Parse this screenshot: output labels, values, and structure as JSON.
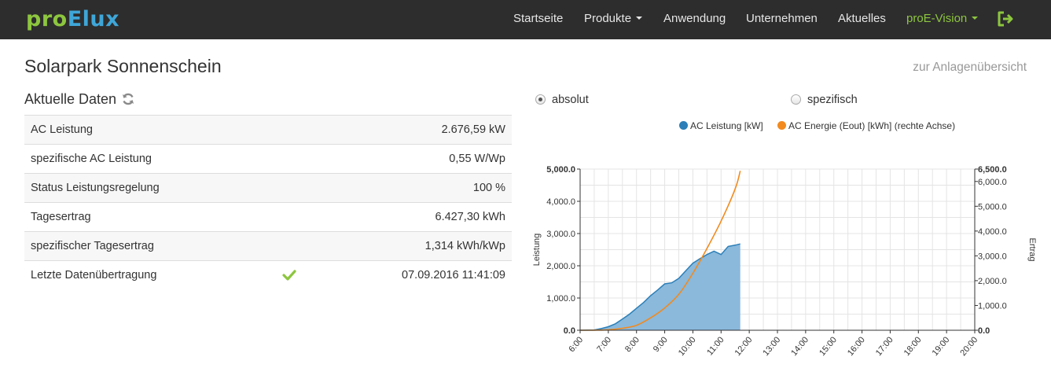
{
  "brand": {
    "part1": "pro",
    "part2": "Elux"
  },
  "nav": {
    "items": [
      {
        "label": "Startseite",
        "caret": false,
        "active": false
      },
      {
        "label": "Produkte",
        "caret": true,
        "active": false
      },
      {
        "label": "Anwendung",
        "caret": false,
        "active": false
      },
      {
        "label": "Unternehmen",
        "caret": false,
        "active": false
      },
      {
        "label": "Aktuelles",
        "caret": false,
        "active": false
      },
      {
        "label": "proE-Vision",
        "caret": true,
        "active": true
      }
    ],
    "logout_icon": "logout-icon"
  },
  "page": {
    "title": "Solarpark Sonnenschein",
    "overview_link": "zur Anlagenübersicht"
  },
  "current": {
    "title": "Aktuelle Daten",
    "refresh_icon": "refresh-icon",
    "rows": [
      {
        "label": "AC Leistung",
        "value": "2.676,59 kW"
      },
      {
        "label": "spezifische AC Leistung",
        "value": "0,55 W/Wp"
      },
      {
        "label": "Status Leistungsregelung",
        "value": "100 %"
      },
      {
        "label": "Tagesertrag",
        "value": "6.427,30 kWh"
      },
      {
        "label": "spezifischer Tagesertrag",
        "value": "1,314 kWh/kWp"
      },
      {
        "label": "Letzte Datenübertragung",
        "value": "07.09.2016 11:41:09",
        "icon": "check-icon"
      }
    ]
  },
  "toggle": {
    "options": [
      {
        "label": "absolut",
        "checked": true
      },
      {
        "label": "spezifisch",
        "checked": false
      }
    ]
  },
  "colors": {
    "brand_green": "#8dc63f",
    "brand_blue": "#3fa6d8",
    "series_power": "#2c7fb8",
    "series_power_fill": "#8ab9dc",
    "series_energy": "#f28a1e",
    "check": "#8dc63f"
  },
  "chart_data": {
    "type": "area",
    "x_ticks": [
      "6:00",
      "7:00",
      "8:00",
      "9:00",
      "10:00",
      "11:00",
      "12:00",
      "13:00",
      "14:00",
      "15:00",
      "16:00",
      "17:00",
      "18:00",
      "19:00",
      "20:00"
    ],
    "xlim": [
      6,
      20
    ],
    "ylabel_left": "Leistung",
    "ylabel_right": "Ertrag",
    "ylim_left": [
      0,
      5000
    ],
    "ylim_right": [
      0,
      6500
    ],
    "left_ticks": [
      "0.0",
      "1,000.0",
      "2,000.0",
      "3,000.0",
      "4,000.0",
      "5,000.0"
    ],
    "right_ticks": [
      "0.0",
      "1,000.0",
      "2,000.0",
      "3,000.0",
      "4,000.0",
      "5,000.0",
      "6,000.0",
      "6,500.0"
    ],
    "grid": true,
    "legend_position": "top",
    "series": [
      {
        "name": "AC Leistung [kW]",
        "axis": "left",
        "kind": "area",
        "x": [
          6.0,
          6.5,
          6.75,
          7.0,
          7.25,
          7.5,
          7.75,
          8.0,
          8.25,
          8.5,
          8.75,
          9.0,
          9.25,
          9.5,
          9.75,
          10.0,
          10.25,
          10.5,
          10.75,
          11.0,
          11.25,
          11.5,
          11.68
        ],
        "values": [
          0,
          10,
          50,
          110,
          200,
          350,
          500,
          680,
          860,
          1070,
          1250,
          1440,
          1470,
          1610,
          1850,
          2080,
          2220,
          2350,
          2450,
          2350,
          2600,
          2640,
          2677
        ]
      },
      {
        "name": "AC Energie (Eout) [kWh] (rechte Achse)",
        "axis": "right",
        "kind": "line",
        "x": [
          6.0,
          6.5,
          7.0,
          7.5,
          8.0,
          8.5,
          9.0,
          9.5,
          10.0,
          10.5,
          11.0,
          11.5,
          11.68
        ],
        "values": [
          0,
          3,
          20,
          80,
          200,
          500,
          900,
          1450,
          2300,
          3300,
          4400,
          5700,
          6427
        ]
      }
    ]
  }
}
